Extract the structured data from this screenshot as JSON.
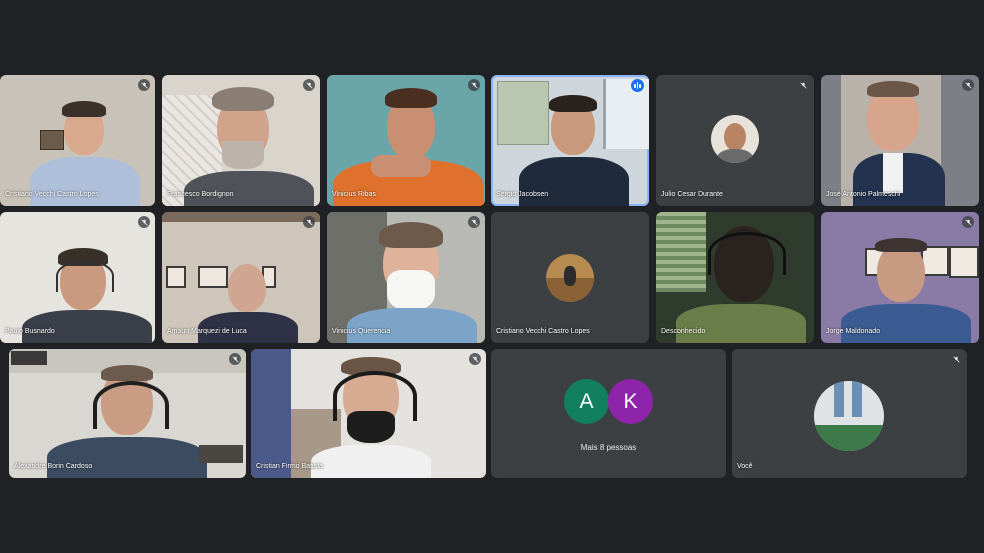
{
  "participants": [
    {
      "name": "Cristiano Vecchi Castro Lopes",
      "muted": true
    },
    {
      "name": "Francesco Bordignon",
      "muted": true
    },
    {
      "name": "Vinicius Ribas",
      "muted": true
    },
    {
      "name": "Sergio Jacobsen",
      "muted": false,
      "speaking": true
    },
    {
      "name": "Julio Cesar Durante",
      "muted": true
    },
    {
      "name": "José Antonio Palmeschi",
      "muted": true
    },
    {
      "name": "Paulo Busnardo",
      "muted": true
    },
    {
      "name": "Amauri Marquezi de Luca",
      "muted": true
    },
    {
      "name": "Vinicius Querencia",
      "muted": true
    },
    {
      "name": "Cristiano Vecchi Castro Lopes",
      "muted": false
    },
    {
      "name": "Desconhecido",
      "muted": false
    },
    {
      "name": "Jorge Maldonado",
      "muted": true
    },
    {
      "name": "Alexandre Borin Cardoso",
      "muted": true
    },
    {
      "name": "Cristian Firmo Batista",
      "muted": true
    },
    {
      "name": "Você",
      "muted": true
    }
  ],
  "more_people": {
    "label": "Mais 8 pessoas",
    "initials": [
      "A",
      "K"
    ],
    "colors": [
      "#12805c",
      "#8e24aa"
    ]
  },
  "colors": {
    "background": "#202124",
    "tile": "#3c4043",
    "active_speaker": "#1a73e8"
  }
}
